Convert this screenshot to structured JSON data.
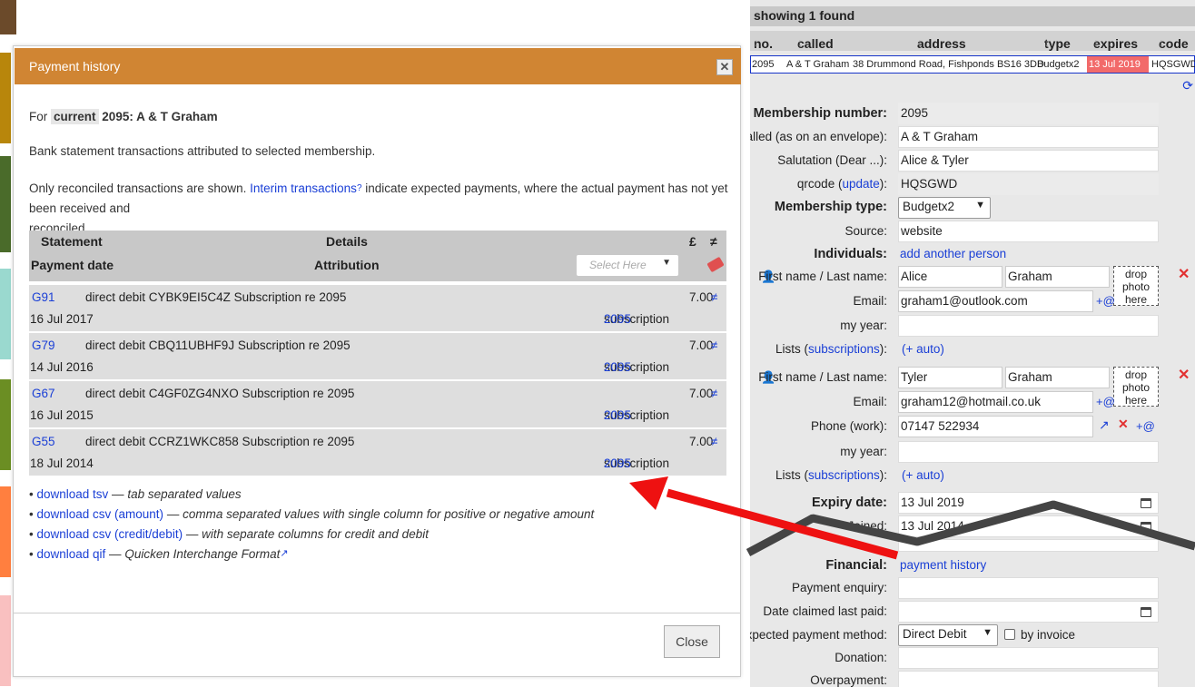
{
  "right_panel": {
    "found_text": "showing 1 found",
    "columns": [
      "no.",
      "called",
      "address",
      "type",
      "expires",
      "code"
    ],
    "result": {
      "no": "2095",
      "called": "A & T Graham",
      "address": "38 Drummond Road, Fishponds BS16 3DD",
      "type": "Budgetx2",
      "expires": "13 Jul 2019",
      "code": "HQSGWD"
    },
    "fields": {
      "membership_number_label": "Membership number:",
      "membership_number": "2095",
      "called_label": "Called (as on an envelope):",
      "called": "A & T Graham",
      "salutation_label": "Salutation (Dear ...):",
      "salutation": "Alice & Tyler",
      "qrcode_label_a": "qrcode (",
      "qrcode_update": "update",
      "qrcode_label_b": "):",
      "qrcode": "HQSGWD",
      "membership_type_label": "Membership type:",
      "membership_type": "Budgetx2",
      "source_label": "Source:",
      "source": "website",
      "individuals_label": "Individuals:",
      "add_person": "add another person",
      "name_label": "First name / Last name:",
      "email_label": "Email:",
      "phone_label": "Phone (work):",
      "myyear_label": "my year:",
      "lists_label_a": "Lists (",
      "lists_subs": "subscriptions",
      "lists_label_b": "):",
      "auto": "(+ auto)",
      "drop_photo": "drop photo here",
      "plus_at": "+@",
      "expiry_label": "Expiry date:",
      "expiry": "13 Jul 2019",
      "joined_label": "Joined:",
      "joined": "13 Jul 2014",
      "financial_label": "Financial:",
      "payment_history": "payment history",
      "payment_enquiry_label": "Payment enquiry:",
      "date_claimed_label": "Date claimed last paid:",
      "expected_method_label": "Expected payment method:",
      "expected_method": "Direct Debit",
      "by_invoice": "by invoice",
      "donation_label": "Donation:",
      "overpayment_label": "Overpayment:"
    },
    "persons": [
      {
        "first": "Alice",
        "last": "Graham",
        "email": "graham1@outlook.com"
      },
      {
        "first": "Tyler",
        "last": "Graham",
        "email": "graham12@hotmail.co.uk",
        "phone": "07147 522934"
      }
    ]
  },
  "modal": {
    "title": "Payment history",
    "for_prefix": "For",
    "for_badge": "current",
    "for_member": "2095: A & T Graham",
    "intro": "Bank statement transactions attributed to selected membership.",
    "note_a": "Only reconciled transactions are shown.",
    "note_link": "Interim transactions",
    "note_b": "indicate expected payments, where the actual payment has not yet been received and",
    "note_c": "reconciled.",
    "headers": {
      "statement": "Statement",
      "details": "Details",
      "pound": "£",
      "neq": "≠",
      "payment_date": "Payment date",
      "attribution": "Attribution",
      "select_placeholder": "Select Here"
    },
    "rows": [
      {
        "stmt": "G91",
        "detail": "direct debit CYBK9EI5C4Z Subscription re 2095",
        "amount": "7.00",
        "date": "16 Jul 2017",
        "attr": "subscription",
        "attr_link": "2095"
      },
      {
        "stmt": "G79",
        "detail": "direct debit CBQ11UBHF9J Subscription re 2095",
        "amount": "7.00",
        "date": "14 Jul 2016",
        "attr": "subscription",
        "attr_link": "2095"
      },
      {
        "stmt": "G67",
        "detail": "direct debit C4GF0ZG4NXO Subscription re 2095",
        "amount": "7.00",
        "date": "16 Jul 2015",
        "attr": "subscription",
        "attr_link": "2095"
      },
      {
        "stmt": "G55",
        "detail": "direct debit CCRZ1WKC858 Subscription re 2095",
        "amount": "7.00",
        "date": "18 Jul 2014",
        "attr": "subscription",
        "attr_link": "2095"
      }
    ],
    "downloads": [
      {
        "link": "download tsv",
        "desc": "tab separated values"
      },
      {
        "link": "download csv (amount)",
        "desc": "comma separated values with single column for positive or negative amount"
      },
      {
        "link": "download csv (credit/debit)",
        "desc": "with separate columns for credit and debit"
      },
      {
        "link": "download qif",
        "desc": "Quicken Interchange Format"
      }
    ],
    "close_label": "Close"
  },
  "colors": {
    "header": "#d08533",
    "expired": "#f26a6a",
    "link": "#1a3fd6",
    "arrow": "#ee1111"
  }
}
